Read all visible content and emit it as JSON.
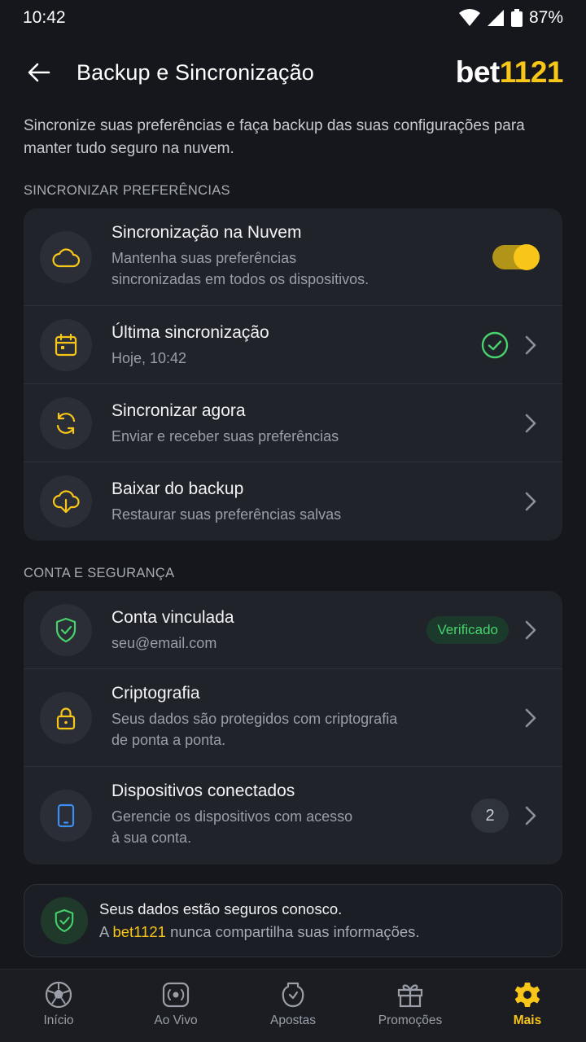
{
  "status": {
    "time": "10:42",
    "battery": "87%"
  },
  "header": {
    "title": "Backup e Sincronização",
    "brand_a": "bet",
    "brand_b": "1121"
  },
  "intro": "Sincronize suas preferências e faça backup das suas configurações para manter tudo seguro na nuvem.",
  "sections": {
    "sync_label": "SINCRONIZAR PREFERÊNCIAS",
    "account_label": "CONTA E SEGURANÇA"
  },
  "sync": {
    "cloud": {
      "title": "Sincronização na Nuvem",
      "sub1": "Mantenha suas preferências",
      "sub2": "sincronizadas em todos os dispositivos.",
      "enabled": true
    },
    "last": {
      "title": "Última sincronização",
      "sub": "Hoje, 10:42"
    },
    "now": {
      "title": "Sincronizar agora",
      "sub": "Enviar e receber suas preferências"
    },
    "download": {
      "title": "Baixar do backup",
      "sub": "Restaurar suas preferências salvas"
    }
  },
  "account": {
    "linked": {
      "title": "Conta vinculada",
      "sub": "seu@email.com",
      "badge": "Verificado"
    },
    "crypto": {
      "title": "Criptografia",
      "sub1": "Seus dados são protegidos com criptografia",
      "sub2": "de ponta a ponta."
    },
    "devices": {
      "title": "Dispositivos conectados",
      "sub1": "Gerencie os dispositivos com acesso",
      "sub2": "à sua conta.",
      "count": "2"
    }
  },
  "info": {
    "line1": "Seus dados estão seguros conosco.",
    "line2_pre": "A ",
    "line2_brand": "bet1121",
    "line2_post": " nunca compartilha suas informações."
  },
  "nav": [
    {
      "label": "Início",
      "icon": "soccer-ball-icon"
    },
    {
      "label": "Ao Vivo",
      "icon": "live-icon"
    },
    {
      "label": "Apostas",
      "icon": "betslip-icon"
    },
    {
      "label": "Promoções",
      "icon": "gift-icon"
    },
    {
      "label": "Mais",
      "icon": "gear-icon",
      "active": true
    }
  ],
  "colors": {
    "accent": "#f7c619",
    "success": "#47d26c",
    "background": "#15171c",
    "card": "#20232a",
    "device_icon": "#3b8ff3"
  }
}
